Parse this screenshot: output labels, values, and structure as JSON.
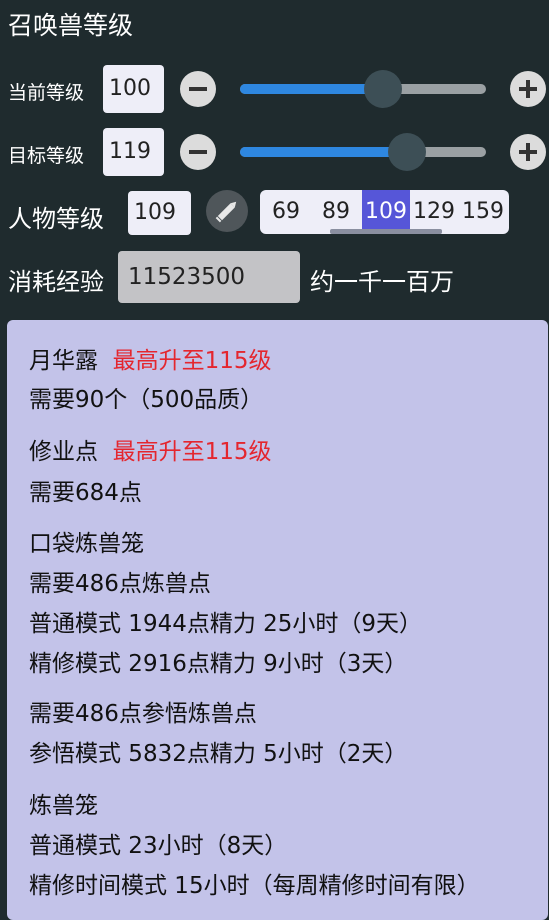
{
  "title": "召唤兽等级",
  "current_level": {
    "label": "当前等级",
    "value": "100",
    "slider_fraction": 0.58
  },
  "target_level": {
    "label": "目标等级",
    "value": "119",
    "slider_fraction": 0.68
  },
  "character_level": {
    "label": "人物等级",
    "value": "109",
    "presets": [
      "69",
      "89",
      "109",
      "129",
      "159"
    ],
    "active_preset": "109"
  },
  "exp_cost": {
    "label": "消耗经验",
    "value": "11523500",
    "text": "约一千一百万"
  },
  "results": {
    "yuehualu": {
      "name": "月华露",
      "cap": "最高升至115级",
      "need": "需要90个（500品质）"
    },
    "xiuyedian": {
      "name": "修业点",
      "cap": "最高升至115级",
      "need": "需要684点"
    },
    "pocket_cage": {
      "name": "口袋炼兽笼",
      "need": "需要486点炼兽点",
      "normal": "普通模式 1944点精力 25小时（9天）",
      "refine": "精修模式 2916点精力 9小时（3天）"
    },
    "insight": {
      "need": "需要486点参悟炼兽点",
      "mode": "参悟模式 5832点精力 5小时（2天）"
    },
    "cage": {
      "name": "炼兽笼",
      "normal": "普通模式 23小时（8天）",
      "refine_time": "精修时间模式 15小时（每周精修时间有限）"
    }
  },
  "colors": {
    "background": "#1f2b2e",
    "panel": "#c3c3e9",
    "accent": "#2e87e0",
    "highlight": "#e4262e",
    "selected": "#5656d8"
  }
}
